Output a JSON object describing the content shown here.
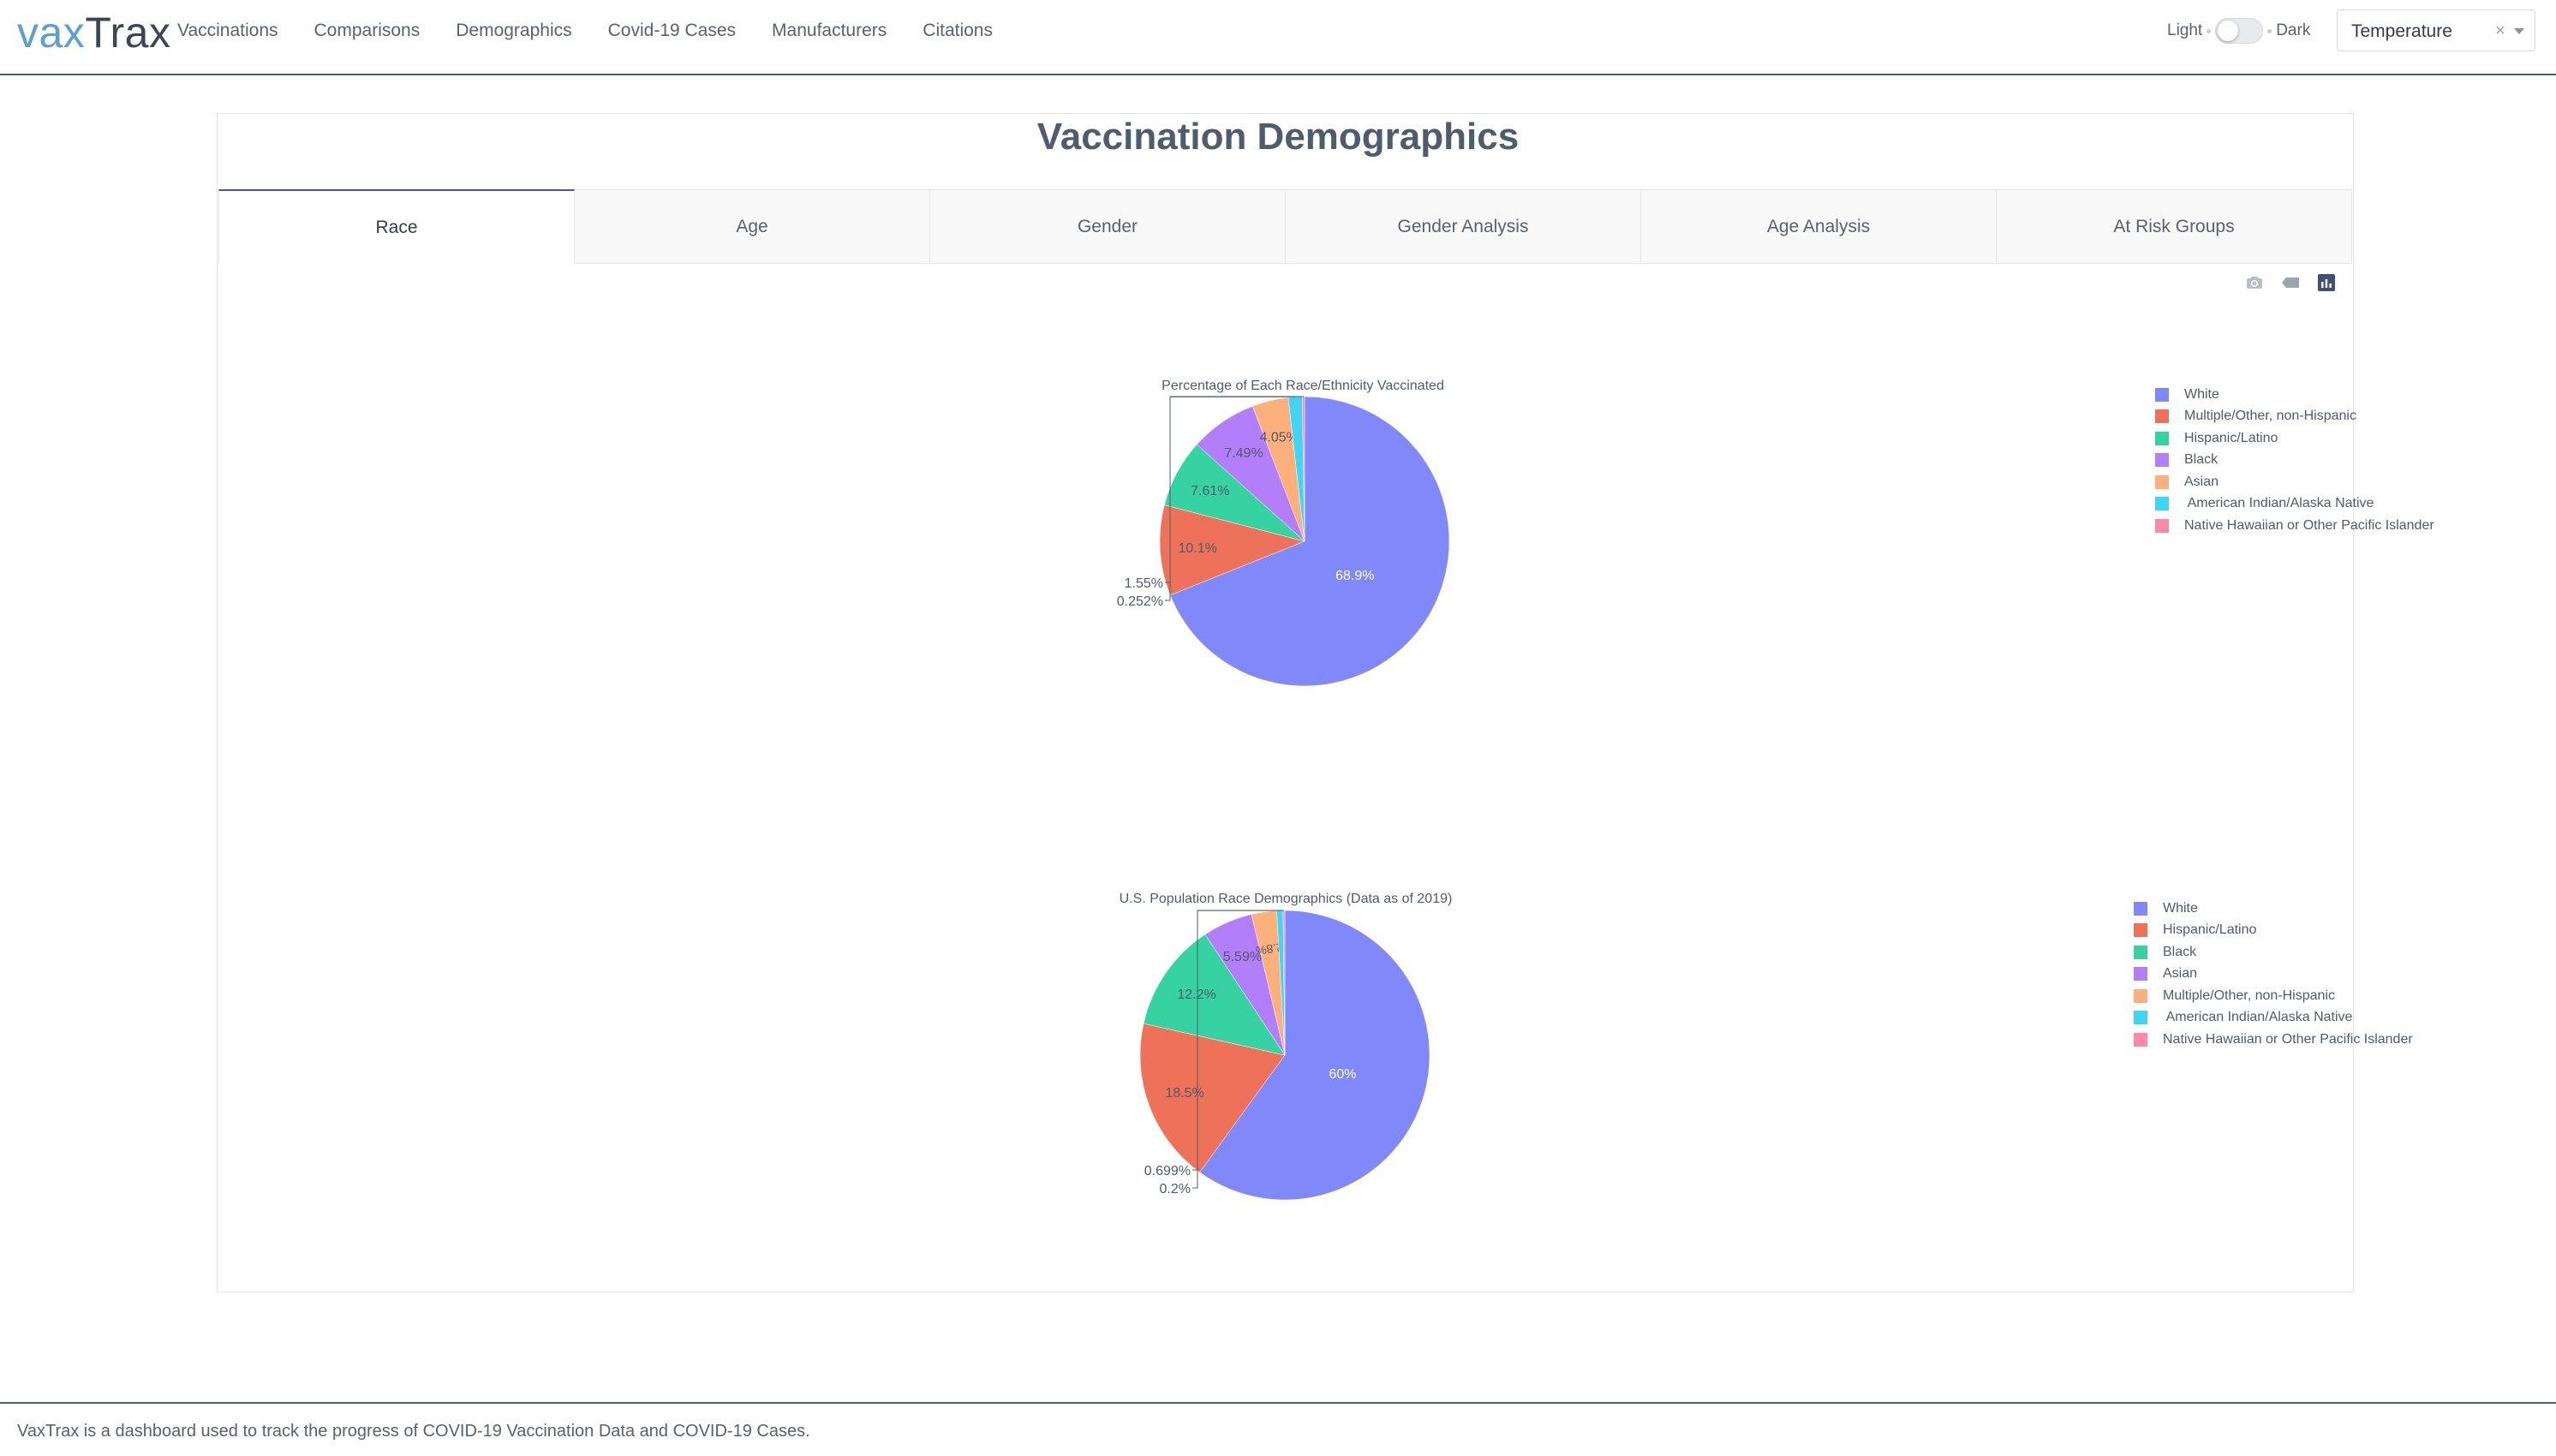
{
  "navbar": {
    "brand_part1": "vax",
    "brand_part2": "Trax",
    "links": [
      "Vaccinations",
      "Comparisons",
      "Demographics",
      "Covid-19 Cases",
      "Manufacturers",
      "Citations"
    ],
    "theme_light_label": "Light",
    "theme_dark_label": "Dark",
    "theme_dark_enabled": false,
    "theme_select": {
      "value": "Temperature",
      "clear_glyph": "×"
    }
  },
  "page": {
    "title": "Vaccination Demographics",
    "tabs": [
      "Race",
      "Age",
      "Gender",
      "Gender Analysis",
      "Age Analysis",
      "At Risk Groups"
    ],
    "active_tab": "Race"
  },
  "modebar": {
    "icons": [
      "camera-icon",
      "tag-icon",
      "plotly-logo-icon"
    ]
  },
  "colors": {
    "White": "#8188f9",
    "Hispanic/Latino": "#ee715a",
    "Multiple/Other, non-Hispanic": "#ee715a",
    "Black": "#36d2a1",
    "Asian": "#b27efa",
    "Orange": "#fdb07c",
    "Cyan": "#41d5f3",
    "Pink": "#fb89a8"
  },
  "chart_data": [
    {
      "type": "pie",
      "title": "Percentage of Each Race/Ethnicity Vaccinated",
      "sort": "descending-clockwise",
      "slices": [
        {
          "label": "White",
          "value": 68.9,
          "text": "68.9%",
          "color": "#8188f9"
        },
        {
          "label": "Multiple/Other, non-Hispanic",
          "value": 10.1,
          "text": "10.1%",
          "color": "#ee715a"
        },
        {
          "label": "Hispanic/Latino",
          "value": 7.61,
          "text": "7.61%",
          "color": "#36d2a1"
        },
        {
          "label": "Black",
          "value": 7.49,
          "text": "7.49%",
          "color": "#b27efa"
        },
        {
          "label": "Asian",
          "value": 4.05,
          "text": "4.05%",
          "color": "#fdb07c"
        },
        {
          "label": " American Indian/Alaska Native",
          "value": 1.55,
          "text": "1.55%",
          "color": "#41d5f3"
        },
        {
          "label": "Native Hawaiian or Other Pacific Islander",
          "value": 0.252,
          "text": "0.252%",
          "color": "#fb89a8"
        }
      ],
      "legend_position": "top-right"
    },
    {
      "type": "pie",
      "title": "U.S. Population Race Demographics (Data as of 2019)",
      "sort": "descending-clockwise",
      "slices": [
        {
          "label": "White",
          "value": 60,
          "text": "60%",
          "color": "#8188f9"
        },
        {
          "label": "Hispanic/Latino",
          "value": 18.5,
          "text": "18.5%",
          "color": "#ee715a"
        },
        {
          "label": "Black",
          "value": 12.2,
          "text": "12.2%",
          "color": "#36d2a1"
        },
        {
          "label": "Asian",
          "value": 5.59,
          "text": "5.59%",
          "color": "#b27efa"
        },
        {
          "label": "Multiple/Other, non-Hispanic",
          "value": 2.8,
          "text": "2.8%",
          "color": "#fdb07c"
        },
        {
          "label": " American Indian/Alaska Native",
          "value": 0.699,
          "text": "0.699%",
          "color": "#41d5f3"
        },
        {
          "label": "Native Hawaiian or Other Pacific Islander",
          "value": 0.2,
          "text": "0.2%",
          "color": "#fb89a8"
        }
      ],
      "legend_position": "top-right"
    }
  ],
  "footer": {
    "text": "VaxTrax is a dashboard used to track the progress of COVID-19 Vaccination Data and COVID-19 Cases."
  }
}
